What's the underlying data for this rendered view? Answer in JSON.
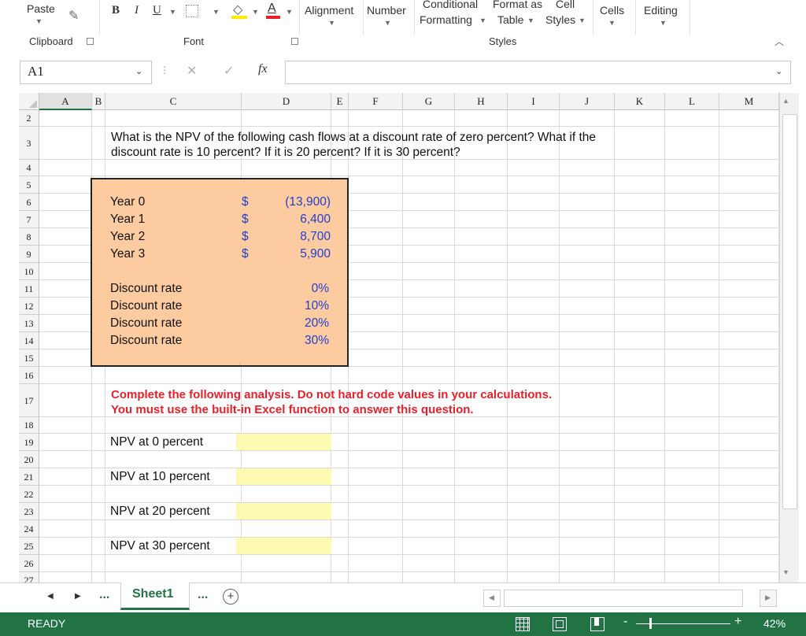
{
  "ribbon": {
    "paste": "Paste",
    "bold": "B",
    "italic": "I",
    "underline": "U",
    "alignment": "Alignment",
    "number": "Number",
    "conditional_formatting_1": "Conditional",
    "conditional_formatting_2": "Formatting",
    "format_as_table_1": "Format as",
    "format_as_table_2": "Table",
    "cell_styles_1": "Cell",
    "cell_styles_2": "Styles",
    "cells": "Cells",
    "editing": "Editing",
    "group_clipboard": "Clipboard",
    "group_font": "Font",
    "group_styles": "Styles"
  },
  "formula_bar": {
    "name_box": "A1",
    "cancel": "✕",
    "enter": "✓",
    "fx": "fx",
    "formula": ""
  },
  "columns": [
    "A",
    "B",
    "C",
    "D",
    "E",
    "F",
    "G",
    "H",
    "I",
    "J",
    "K",
    "L",
    "M"
  ],
  "rows": [
    "2",
    "3",
    "4",
    "5",
    "6",
    "7",
    "8",
    "9",
    "10",
    "11",
    "12",
    "13",
    "14",
    "15",
    "16",
    "17",
    "18",
    "19",
    "20",
    "21",
    "22",
    "23",
    "24",
    "25",
    "26",
    "27"
  ],
  "question_line1": "What is the NPV of the following cash flows at a discount rate of zero percent? What if the",
  "question_line2": "discount rate is 10 percent? If it is 20 percent? If it is 30 percent?",
  "cash_flows": [
    {
      "label": "Year 0",
      "currency": "$",
      "value": "(13,900)"
    },
    {
      "label": "Year 1",
      "currency": "$",
      "value": "6,400"
    },
    {
      "label": "Year 2",
      "currency": "$",
      "value": "8,700"
    },
    {
      "label": "Year 3",
      "currency": "$",
      "value": "5,900"
    }
  ],
  "discount_rates": [
    {
      "label": "Discount rate",
      "value": "0%"
    },
    {
      "label": "Discount rate",
      "value": "10%"
    },
    {
      "label": "Discount rate",
      "value": "20%"
    },
    {
      "label": "Discount rate",
      "value": "30%"
    }
  ],
  "instruction_line1": "Complete the following analysis. Do not hard code values in your calculations.",
  "instruction_line2": "You must use the built-in Excel function to answer this question.",
  "npv_labels": [
    {
      "label": "NPV at 0 percent",
      "value": ""
    },
    {
      "label": "NPV at 10 percent",
      "value": ""
    },
    {
      "label": "NPV at 20 percent",
      "value": ""
    },
    {
      "label": "NPV at 30 percent",
      "value": ""
    }
  ],
  "tabs": {
    "ellipsis_left": "...",
    "sheet": "Sheet1",
    "ellipsis_right": "...",
    "add": "+"
  },
  "status": {
    "ready": "READY",
    "zoom": "42%"
  },
  "colors": {
    "excel_green": "#217346",
    "table_fill": "#fccca0",
    "input_fill": "#fdfbb1",
    "value_blue": "#1f3fd0",
    "instruction_red": "#e8202a"
  }
}
